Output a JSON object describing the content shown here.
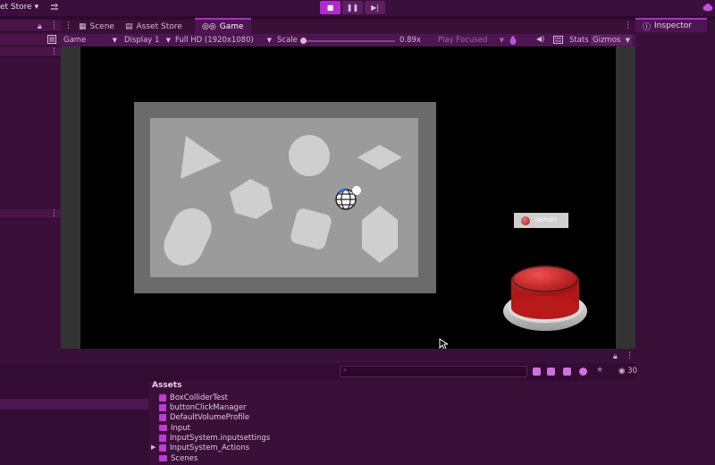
{
  "toolbar": {
    "asset_store_menu": "et Store",
    "play_icon": "play-icon",
    "pause_icon": "pause-icon",
    "step_icon": "step-icon"
  },
  "tabs": [
    {
      "label": "Scene",
      "icon": "scene-icon"
    },
    {
      "label": "Asset Store",
      "icon": "store-icon"
    },
    {
      "label": "Game",
      "icon": "gamepad-icon"
    }
  ],
  "game_toolbar": {
    "view_mode": "Game",
    "display": "Display 1",
    "resolution": "Full HD (1920x1080)",
    "scale_label": "Scale",
    "scale_value": "0.89x",
    "play_focused": "Play Focused",
    "stats": "Stats",
    "gizmos": "Gizmos"
  },
  "game": {
    "deport_label": "DEPORT"
  },
  "inspector": {
    "tab_label": "Inspector"
  },
  "project": {
    "assets_title": "Assets",
    "items": [
      {
        "name": "BoxColliderTest",
        "icon": "script-icon"
      },
      {
        "name": "buttonClickManager",
        "icon": "script-icon"
      },
      {
        "name": "DefaultVolumeProfile",
        "icon": "profile-icon"
      },
      {
        "name": "Input",
        "icon": "folder-icon"
      },
      {
        "name": "InputSystem.inputsettings",
        "icon": "settings-icon"
      },
      {
        "name": "InputSystem_Actions",
        "icon": "actions-icon"
      },
      {
        "name": "Scenes",
        "icon": "folder-icon"
      }
    ],
    "count": "30"
  },
  "colors": {
    "accent": "#b12ad0",
    "panel": "#3a1038",
    "button_red": "#d42a2a"
  }
}
